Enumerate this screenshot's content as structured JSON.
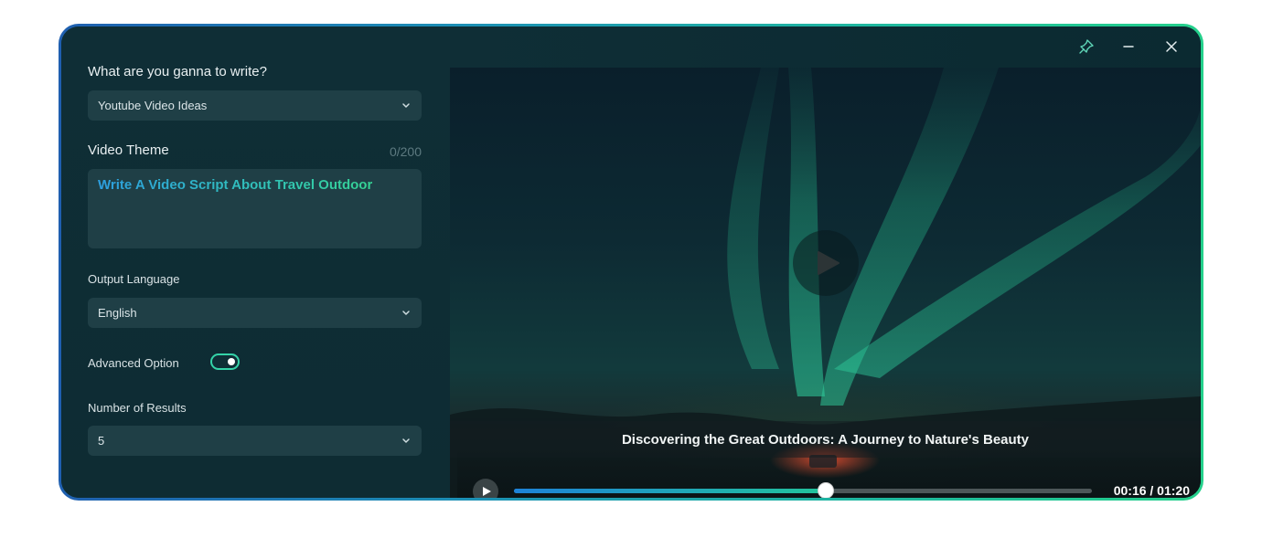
{
  "form": {
    "question_label": "What are you ganna to write?",
    "type_select_value": "Youtube Video Ideas",
    "theme_label": "Video Theme",
    "theme_counter": "0/200",
    "theme_text": "Write A Video Script About Travel Outdoor",
    "language_label": "Output Language",
    "language_value": "English",
    "advanced_label": "Advanced Option",
    "advanced_enabled": true,
    "results_label": "Number of Results",
    "results_value": "5"
  },
  "video": {
    "caption": "Discovering the Great Outdoors: A Journey to Nature's Beauty",
    "time_display": "00:16 / 01:20",
    "progress_fraction": 0.54
  },
  "icons": {
    "pin": "pin-icon",
    "minimize": "minimize-icon",
    "close": "close-icon",
    "chevron": "chevron-down-icon",
    "play": "play-icon"
  },
  "colors": {
    "accent_start": "#1d82d8",
    "accent_end": "#22c49b",
    "toggle_on": "#34d3a8"
  }
}
